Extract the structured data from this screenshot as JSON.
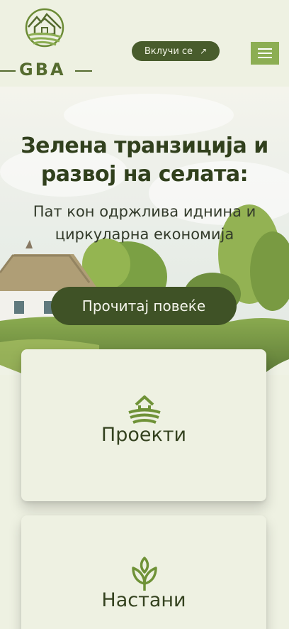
{
  "brand": {
    "name": "GBA",
    "color": "#556b2f"
  },
  "header": {
    "join_label": "Вклучи се",
    "join_icon": "arrow-up-right-icon",
    "menu_icon": "hamburger-icon"
  },
  "hero": {
    "title_line1": "Зелена транзиција и",
    "title_line2": "развој на селата:",
    "subtitle_line1": "Пат кон одржлива иднина и",
    "subtitle_line2": "циркуларна економија",
    "cta_label": "Прочитај повеќе"
  },
  "cards": [
    {
      "label": "Проекти",
      "icon": "farm-field-icon"
    },
    {
      "label": "Настани",
      "icon": "sprout-leaf-icon"
    }
  ],
  "colors": {
    "background": "#eef1e2",
    "button_dark": "#485c2c",
    "menu_green": "#8cae53",
    "text_dark": "#31401d"
  }
}
